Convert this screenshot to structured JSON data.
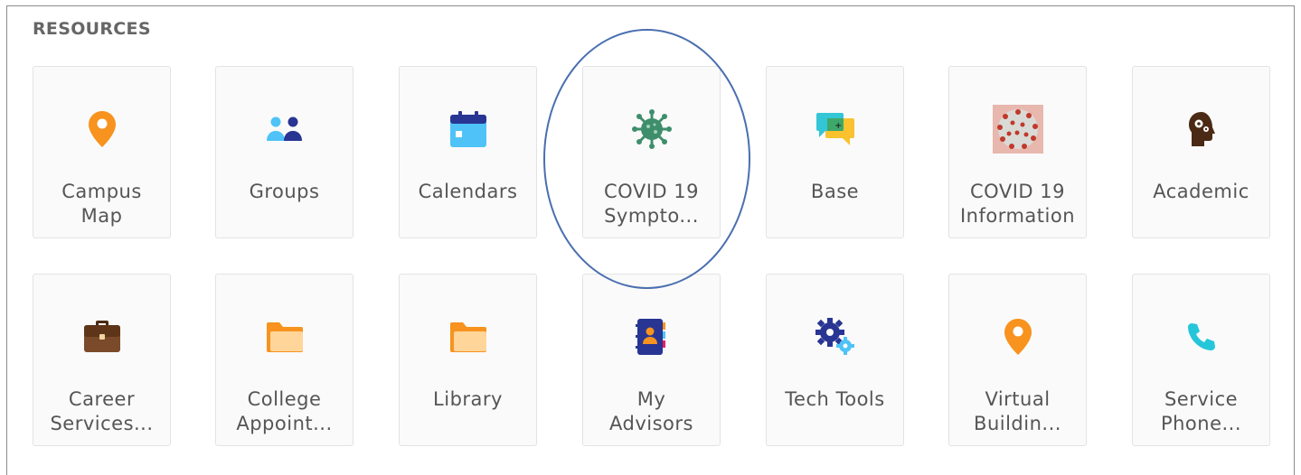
{
  "section": {
    "title": "RESOURCES"
  },
  "tiles": [
    {
      "line1": "Campus",
      "line2": "Map"
    },
    {
      "line1": "Groups",
      "line2": ""
    },
    {
      "line1": "Calendars",
      "line2": ""
    },
    {
      "line1": "COVID 19",
      "line2": "Sympto..."
    },
    {
      "line1": "Base",
      "line2": ""
    },
    {
      "line1": "COVID 19",
      "line2": "Information"
    },
    {
      "line1": "Academic",
      "line2": ""
    },
    {
      "line1": "Career",
      "line2": "Services..."
    },
    {
      "line1": "College",
      "line2": "Appoint..."
    },
    {
      "line1": "Library",
      "line2": ""
    },
    {
      "line1": "My",
      "line2": "Advisors"
    },
    {
      "line1": "Tech Tools",
      "line2": ""
    },
    {
      "line1": "Virtual",
      "line2": "Buildin..."
    },
    {
      "line1": "Service",
      "line2": "Phone..."
    }
  ],
  "colors": {
    "orange": "#f7931e",
    "navy": "#283593",
    "teal": "#4fc3f7",
    "green": "#3e8e6c",
    "brown": "#7b4a2a"
  }
}
